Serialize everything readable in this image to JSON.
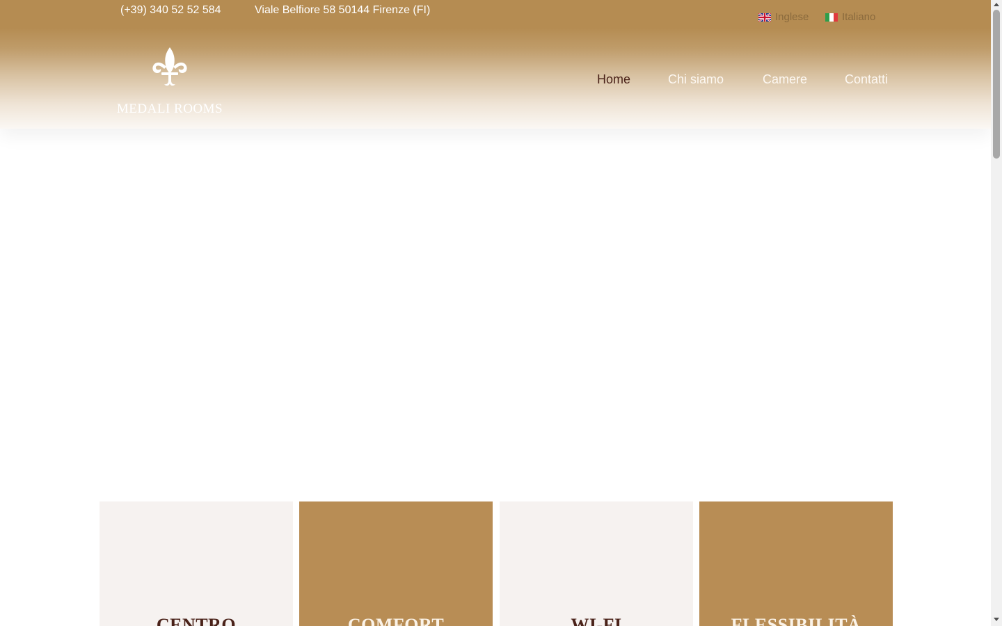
{
  "topbar": {
    "phone": "(+39) 340 52 52 584",
    "address": "Viale Belfiore 58 50144 Firenze (FI)"
  },
  "languages": [
    {
      "label": "Inglese",
      "flag": "uk-flag-icon"
    },
    {
      "label": "Italiano",
      "flag": "italy-flag-icon"
    }
  ],
  "logo": {
    "text": "MEDALI ROOMS",
    "icon": "fleur-de-lis-icon"
  },
  "nav": {
    "items": [
      {
        "label": "Home",
        "active": true
      },
      {
        "label": "Chi siamo",
        "active": false
      },
      {
        "label": "Camere",
        "active": false
      },
      {
        "label": "Contatti",
        "active": false
      }
    ]
  },
  "features": [
    {
      "title": "CENTRO"
    },
    {
      "title": "COMFORT"
    },
    {
      "title": "WI-FI"
    },
    {
      "title": "FLESSIBILITÀ"
    }
  ],
  "colors": {
    "brand_gold": "#b88d55",
    "dark_brown": "#4a2219",
    "light_panel": "#f6f2f0"
  }
}
